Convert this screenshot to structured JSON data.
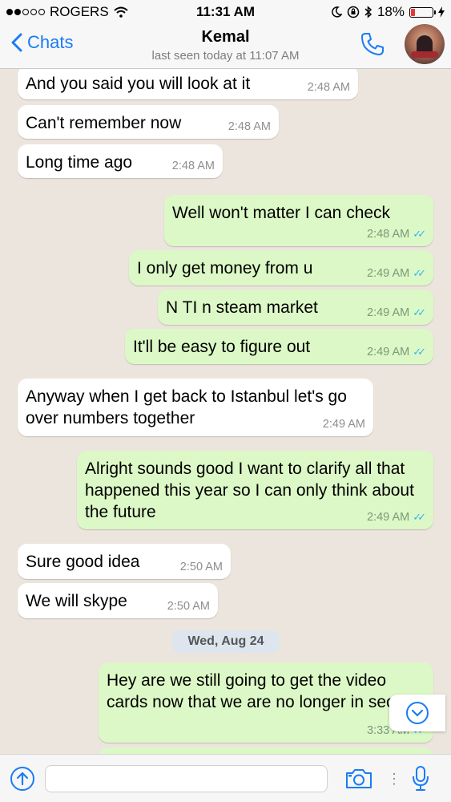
{
  "status_bar": {
    "carrier": "ROGERS",
    "time": "11:31 AM",
    "battery": "18%"
  },
  "nav": {
    "back_label": "Chats",
    "contact_name": "Kemal",
    "last_seen": "last seen today at 11:07 AM"
  },
  "messages": [
    {
      "dir": "in",
      "text": "And you said you will look at it",
      "time": "2:48 AM"
    },
    {
      "dir": "in",
      "text": "Can't remember now",
      "time": "2:48 AM"
    },
    {
      "dir": "in",
      "text": "Long time ago",
      "time": "2:48 AM"
    },
    {
      "dir": "out",
      "text": "Well won't matter I can check",
      "time": "2:48 AM"
    },
    {
      "dir": "out",
      "text": "I only get money from u",
      "time": "2:49 AM"
    },
    {
      "dir": "out",
      "text": "N TI n steam market",
      "time": "2:49 AM"
    },
    {
      "dir": "out",
      "text": "It'll be easy to figure out",
      "time": "2:49 AM"
    },
    {
      "dir": "in",
      "text": "Anyway when I get back to Istanbul let's go over numbers together",
      "time": "2:49 AM"
    },
    {
      "dir": "out",
      "text": "Alright sounds good I want to clarify all that happened this year so I can only think about the future",
      "time": "2:49 AM"
    },
    {
      "dir": "in",
      "text": "Sure good idea",
      "time": "2:50 AM"
    },
    {
      "dir": "in",
      "text": "We will skype",
      "time": "2:50 AM"
    },
    {
      "dir": "out",
      "text": "Hey are we still going to get the video cards now that we are no longer in secret",
      "time": "3:33 AM"
    }
  ],
  "date_separator": "Wed, Aug 24",
  "input": {
    "placeholder": ""
  },
  "colors": {
    "accent": "#1a7cf5",
    "outgoing_bubble": "#dcf8c6",
    "incoming_bubble": "#ffffff",
    "chat_background": "#ece5dd",
    "read_ticks": "#34b7f1"
  },
  "icons": [
    "back-chevron-icon",
    "phone-icon",
    "scroll-down-icon",
    "attach-up-icon",
    "camera-icon",
    "microphone-icon",
    "wifi-icon",
    "bluetooth-icon",
    "moon-icon"
  ]
}
